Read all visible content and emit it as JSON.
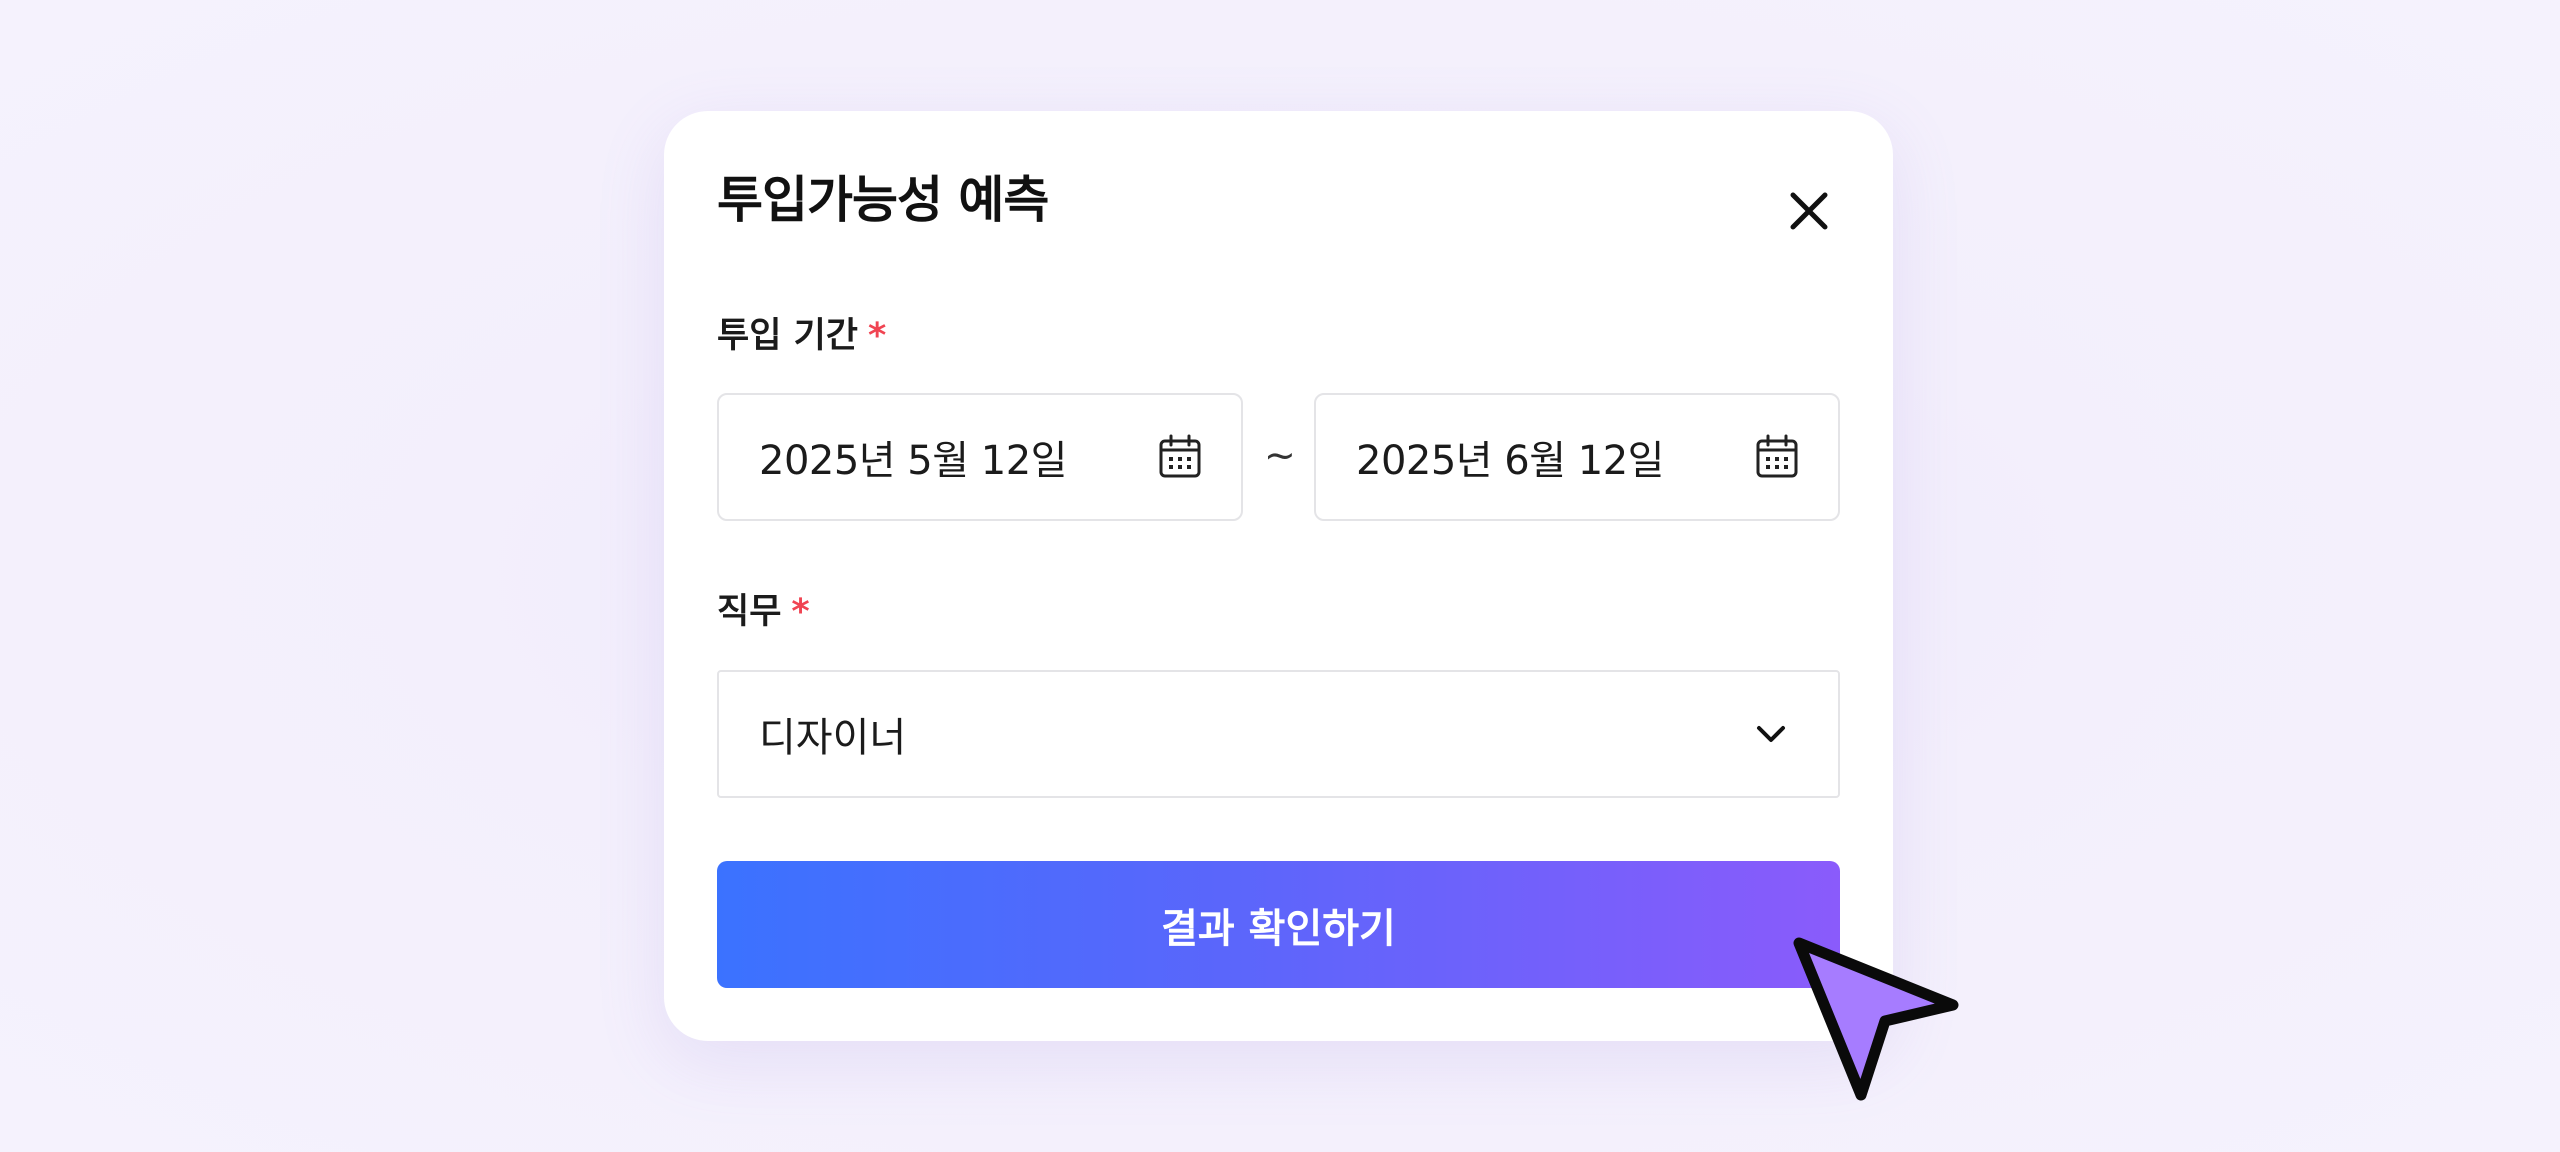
{
  "modal": {
    "title": "투입가능성 예측",
    "close_icon": "close-icon"
  },
  "period": {
    "label": "투입 기간",
    "required_mark": "*",
    "start": {
      "value": "2025년 5월 12일",
      "icon": "calendar-icon"
    },
    "separator": "~",
    "end": {
      "value": "2025년 6월 12일",
      "icon": "calendar-icon"
    }
  },
  "role": {
    "label": "직무",
    "required_mark": "*",
    "selected": "디자이너",
    "icon": "chevron-down-icon"
  },
  "submit": {
    "label": "결과 확인하기"
  },
  "colors": {
    "accent_start": "#3b72ff",
    "accent_end": "#8a5bfb",
    "required": "#f04452",
    "cursor_fill": "#a67cff"
  }
}
